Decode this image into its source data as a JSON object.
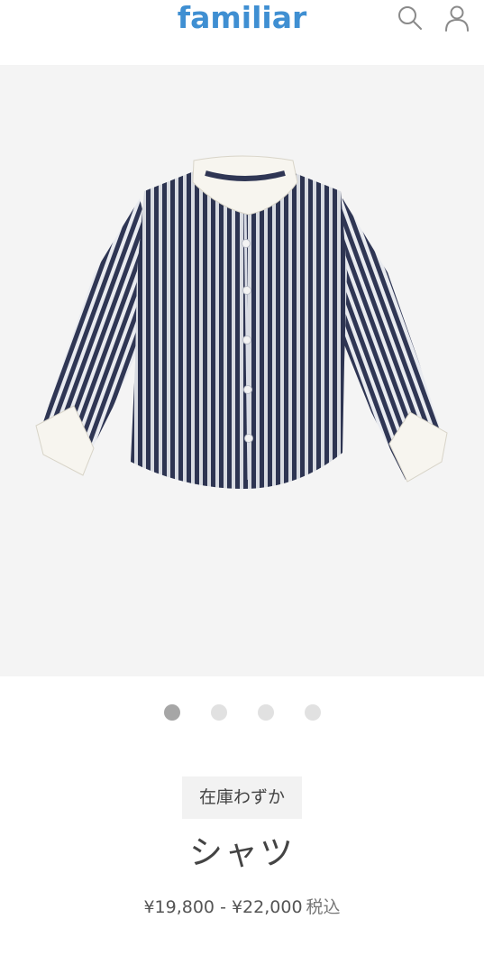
{
  "header": {
    "logo": "familiar",
    "search_icon": "search-icon",
    "account_icon": "user-icon"
  },
  "gallery": {
    "image": "striped-shirt-with-white-collar-and-cuffs",
    "dots": 4,
    "active_index": 0
  },
  "product": {
    "stock_badge": "在庫わずか",
    "name": "シャツ",
    "price_range": "¥19,800 - ¥22,000",
    "tax_label": "税込"
  },
  "colors": {
    "brand": "#3f8fd2",
    "image_bg": "#f4f4f4",
    "dot_active": "#a6a6a6",
    "dot_inactive": "#e1e1e1"
  }
}
